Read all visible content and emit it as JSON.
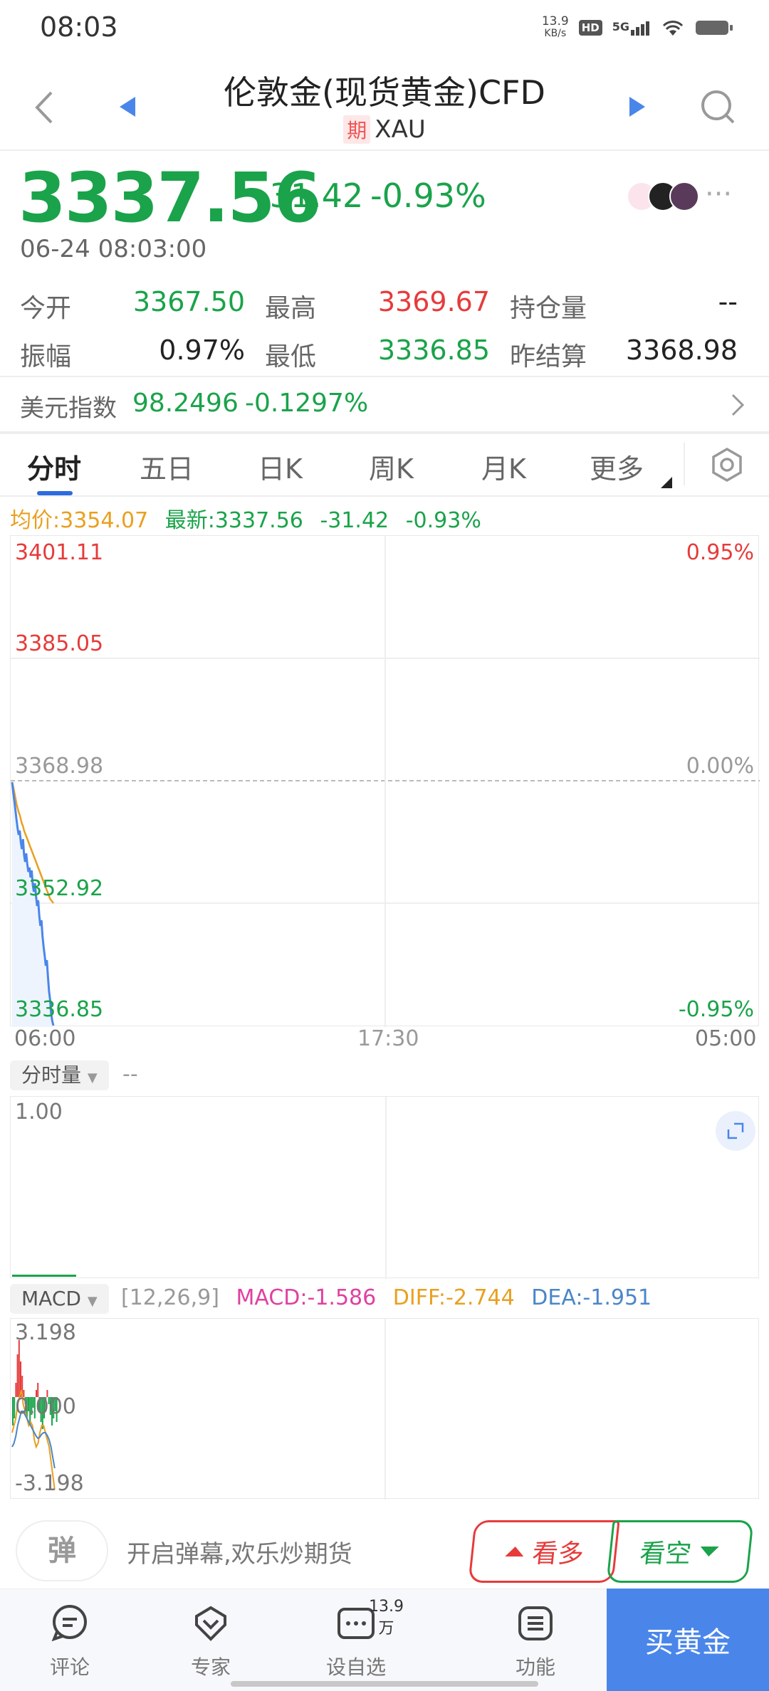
{
  "status": {
    "time": "08:03",
    "speed": "13.9",
    "speed_unit": "KB/s",
    "hd": "HD",
    "net": "5G"
  },
  "header": {
    "title": "伦敦金(现货黄金)CFD",
    "badge": "期",
    "code": "XAU"
  },
  "quote": {
    "price": "3337.56",
    "change": "-31.42",
    "change_pct": "-0.93%",
    "timestamp": "06-24 08:03:00",
    "stats": [
      {
        "label": "今开",
        "value": "3367.50",
        "color": "#1aa34a"
      },
      {
        "label": "最高",
        "value": "3369.67",
        "color": "#e63b3b"
      },
      {
        "label": "持仓量",
        "value": "--",
        "color": "#222222"
      },
      {
        "label": "振幅",
        "value": "0.97%",
        "color": "#222222"
      },
      {
        "label": "最低",
        "value": "3336.85",
        "color": "#1aa34a"
      },
      {
        "label": "昨结算",
        "value": "3368.98",
        "color": "#222222"
      }
    ],
    "usd_index": {
      "label": "美元指数",
      "value": "98.2496",
      "change": "-0.1297%"
    }
  },
  "tabs": [
    "分时",
    "五日",
    "日K",
    "周K",
    "月K",
    "更多"
  ],
  "legend": {
    "avg": "均价:3354.07",
    "latest": "最新:3337.56",
    "chg": "-31.42",
    "pct": "-0.93%"
  },
  "main_chart": {
    "y_labels": [
      "3401.11",
      "3385.05",
      "3368.98",
      "3352.92",
      "3336.85"
    ],
    "pct_labels": [
      "0.95%",
      "0.00%",
      "-0.95%"
    ],
    "x_labels": [
      "06:00",
      "17:30",
      "05:00"
    ]
  },
  "volume": {
    "selector": "分时量",
    "value": "--",
    "max": "1.00"
  },
  "macd": {
    "selector": "MACD",
    "params": "[12,26,9]",
    "macd": "MACD:-1.586",
    "diff": "DIFF:-2.744",
    "dea": "DEA:-1.951",
    "top": "3.198",
    "mid": "0.000",
    "bottom": "-3.198"
  },
  "bottom": {
    "danmu_icon": "弹",
    "danmu_text": "开启弹幕,欢乐炒期货",
    "long": "看多",
    "short": "看空"
  },
  "nav": {
    "comment": "评论",
    "expert": "专家",
    "watchlist": "设自选",
    "watch_count": "13.9万",
    "function": "功能",
    "buy": "买黄金"
  },
  "colors": {
    "up": "#e63b3b",
    "down": "#1aa34a",
    "accent": "#2d6be0",
    "avg_line": "#e8a020",
    "price_line": "#4a86ea"
  }
}
